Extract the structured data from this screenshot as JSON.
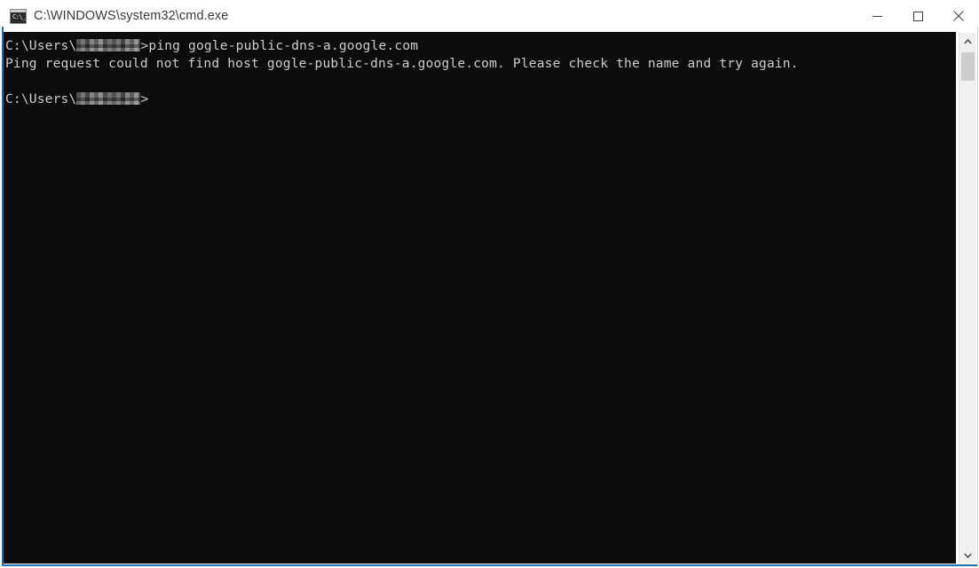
{
  "window": {
    "title": "C:\\WINDOWS\\system32\\cmd.exe",
    "icon": "cmd-console-icon",
    "icon_glyph": "C:\\_",
    "titlebar_bg": "#ffffff",
    "title_color": "#3a3a3a",
    "frame_accent": "#1a6fb5"
  },
  "caption": {
    "minimize": "minimize-button",
    "maximize": "maximize-button",
    "close": "close-button",
    "minimize_label": "Minimize",
    "maximize_label": "Maximize",
    "close_label": "Close"
  },
  "console": {
    "background": "#0c0c0c",
    "foreground": "#cccccc",
    "prompt_path": "C:\\Users\\",
    "redacted_username": "",
    "lines": [
      {
        "type": "prompt_command",
        "prefix": "C:\\Users\\",
        "redacted": true,
        "redacted_width": 72,
        "suffix": ">ping gogle-public-dns-a.google.com"
      },
      {
        "type": "output",
        "text": "Ping request could not find host gogle-public-dns-a.google.com. Please check the name and try again."
      },
      {
        "type": "blank",
        "text": " "
      },
      {
        "type": "prompt",
        "prefix": "C:\\Users\\",
        "redacted": true,
        "redacted_width": 72,
        "suffix": ">"
      }
    ]
  },
  "scrollbar": {
    "up_arrow": "scroll-up-arrow",
    "down_arrow": "scroll-down-arrow",
    "thumb": "scrollbar-thumb",
    "track_color": "#f0f0f0",
    "thumb_color": "#cdcdcd"
  }
}
